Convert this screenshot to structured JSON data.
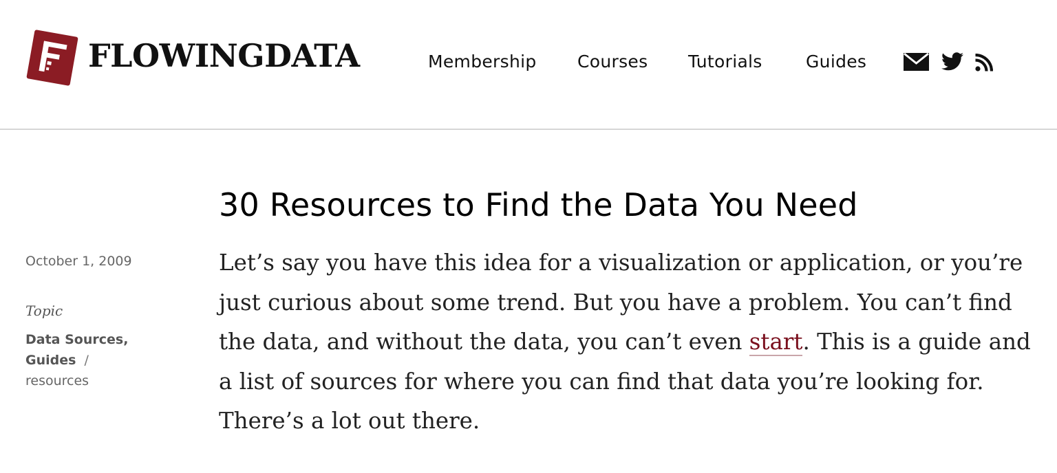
{
  "colors": {
    "brand": "#8b1c24",
    "link": "#7a0f1d",
    "text": "#222222",
    "meta_text": "#666666",
    "divider": "#d6d6d6"
  },
  "header": {
    "logo_text": "FLOWINGDATA",
    "logo_icon": "flowingdata-f-logo",
    "nav": [
      {
        "label": "Membership"
      },
      {
        "label": "Courses"
      },
      {
        "label": "Tutorials"
      },
      {
        "label": "Guides"
      }
    ],
    "social": [
      {
        "icon": "mail-icon"
      },
      {
        "icon": "twitter-icon"
      },
      {
        "icon": "rss-icon"
      }
    ]
  },
  "post": {
    "date": "October 1, 2009",
    "topic_label": "Topic",
    "topics": [
      "Data Sources",
      "Guides"
    ],
    "tags": [
      "resources"
    ],
    "title": "30 Resources to Find the Data You Need",
    "intro_before_link": "Let’s say you have this idea for a visualization or application, or you’re just curious about some trend. But you have a problem. You can’t find the data, and without the data, you can’t even ",
    "intro_link": "start",
    "intro_after_link": ". This is a guide and a list of sources for where you can find that data you’re looking for. There’s a lot out there."
  }
}
